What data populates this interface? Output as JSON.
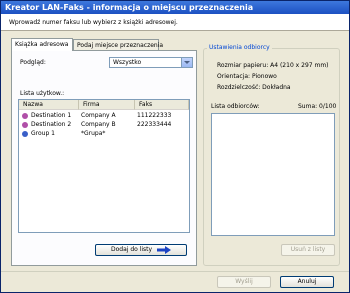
{
  "window": {
    "title": "Kreator LAN-Faks - informacja o miejscu przeznaczenia",
    "instruction": "Wprowadź numer faksu lub wybierz z książki adresowej."
  },
  "tabs": [
    {
      "label": "Książka adresowa",
      "active": true
    },
    {
      "label": "Podaj miejsce przeznaczenia",
      "active": false
    }
  ],
  "address_book": {
    "view_label": "Podgląd:",
    "view_value": "Wszystko",
    "user_list_label": "Lista użytkow.:",
    "columns": [
      "Nazwa",
      "Firma",
      "Faks"
    ],
    "rows": [
      {
        "icon": "person-icon",
        "name": "Destination 1",
        "company": "Company A",
        "fax": "111222333"
      },
      {
        "icon": "person-icon",
        "name": "Destination 2",
        "company": "Company B",
        "fax": "222333444"
      },
      {
        "icon": "group-icon",
        "name": "Group 1",
        "company": "*Grupa*",
        "fax": ""
      }
    ],
    "add_button": "Dodaj do listy"
  },
  "recipient_settings": {
    "group_title": "Ustawienia odbiorcy",
    "paper_size": "Rozmiar papieru: A4 (210 x 297 mm)",
    "orientation": "Orientacja: Pionowo",
    "resolution": "Rozdzielczość: Dokładna",
    "recipient_list_label": "Lista odbiorców:",
    "total": "Suma: 0/100",
    "remove_button": "Usuń z listy"
  },
  "footer": {
    "send_button": "Wyślij",
    "cancel_button": "Anuluj"
  },
  "colors": {
    "title_bar": "#1c50c2",
    "group_title": "#0046d5",
    "arrow": "#1d44c4"
  }
}
